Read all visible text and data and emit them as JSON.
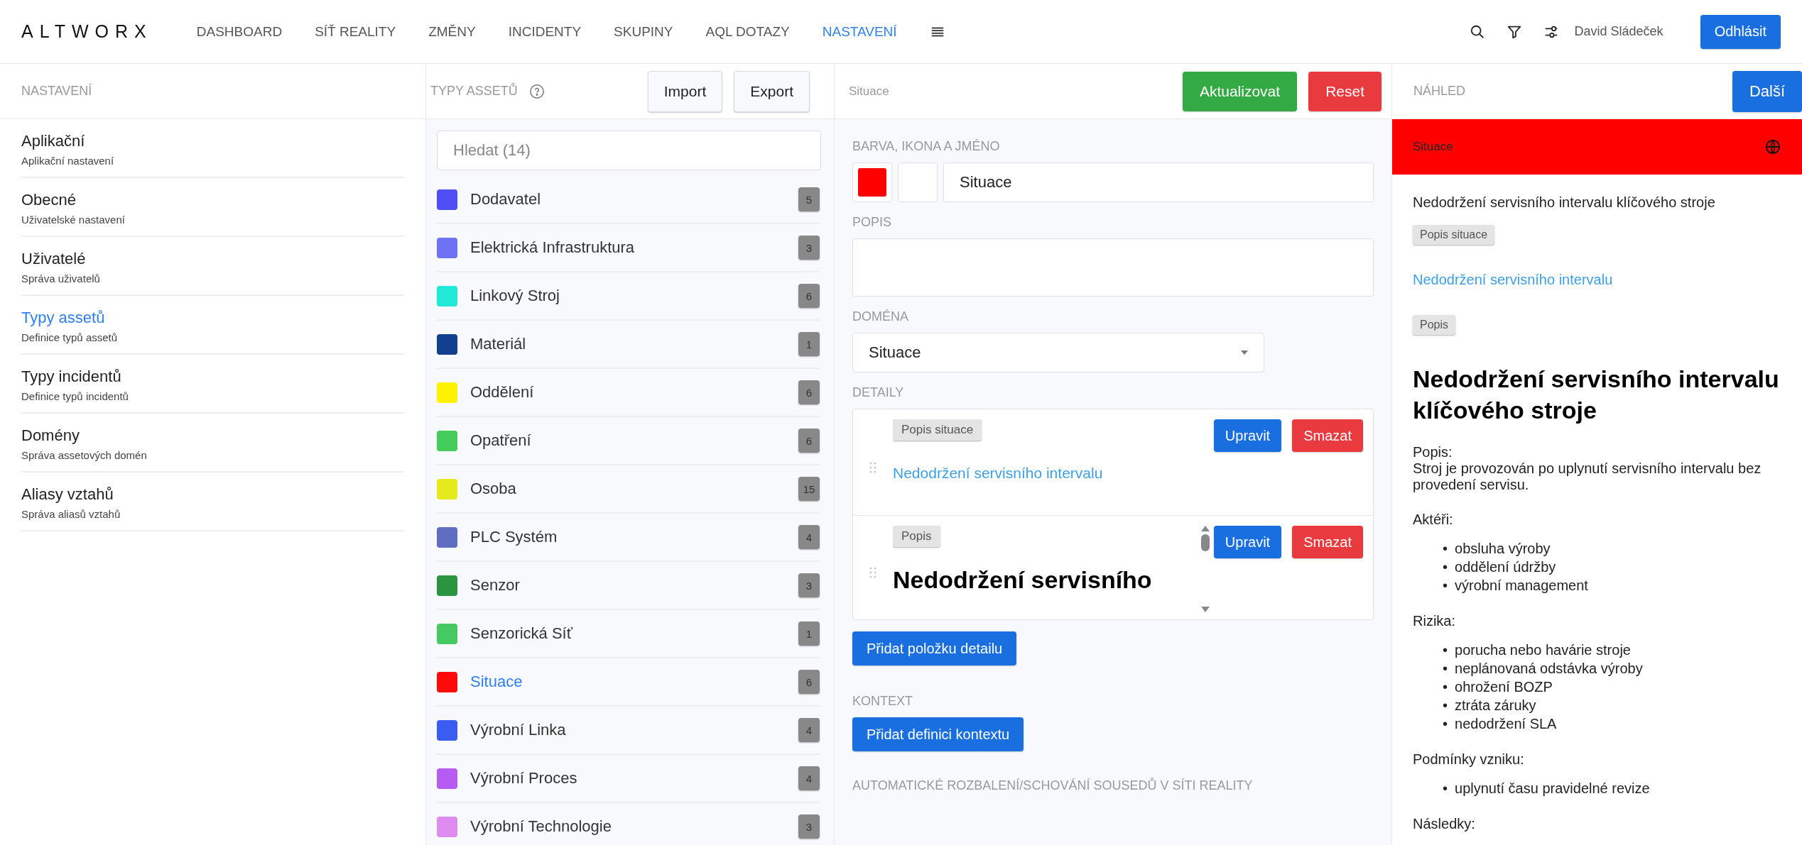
{
  "brand": "ALTWORX",
  "nav": [
    {
      "label": "DASHBOARD",
      "selected": false
    },
    {
      "label": "SÍŤ REALITY",
      "selected": false
    },
    {
      "label": "ZMĚNY",
      "selected": false
    },
    {
      "label": "INCIDENTY",
      "selected": false
    },
    {
      "label": "SKUPINY",
      "selected": false
    },
    {
      "label": "AQL DOTAZY",
      "selected": false
    },
    {
      "label": "NASTAVENÍ",
      "selected": true
    }
  ],
  "user": "David Sládeček",
  "logout": "Odhlásit",
  "settings": {
    "title": "NASTAVENÍ",
    "items": [
      {
        "title": "Aplikační",
        "subtitle": "Aplikační nastavení",
        "selected": false
      },
      {
        "title": "Obecné",
        "subtitle": "Uživatelské nastavení",
        "selected": false
      },
      {
        "title": "Uživatelé",
        "subtitle": "Správa uživatelů",
        "selected": false
      },
      {
        "title": "Typy assetů",
        "subtitle": "Definice typů assetů",
        "selected": true
      },
      {
        "title": "Typy incidentů",
        "subtitle": "Definice typů incidentů",
        "selected": false
      },
      {
        "title": "Domény",
        "subtitle": "Správa assetových domén",
        "selected": false
      },
      {
        "title": "Aliasy vztahů",
        "subtitle": "Správa aliasů vztahů",
        "selected": false
      }
    ]
  },
  "asset_types": {
    "title": "TYPY ASSETŮ",
    "buttons": [
      "Import",
      "Export"
    ],
    "search": {
      "placeholder": "Hledat (14)"
    },
    "items": [
      {
        "name": "Dodavatel",
        "count": "5",
        "color": "#4f4ff5",
        "selected": false
      },
      {
        "name": "Elektrická Infrastruktura",
        "count": "3",
        "color": "#6f72f5",
        "selected": false
      },
      {
        "name": "Linkový Stroj",
        "count": "6",
        "color": "#22e8d8",
        "selected": false
      },
      {
        "name": "Materiál",
        "count": "1",
        "color": "#133f8f",
        "selected": false
      },
      {
        "name": "Oddělení",
        "count": "6",
        "color": "#fff200",
        "selected": false
      },
      {
        "name": "Opatření",
        "count": "6",
        "color": "#44cc5a",
        "selected": false
      },
      {
        "name": "Osoba",
        "count": "15",
        "color": "#e4ea1c",
        "selected": false
      },
      {
        "name": "PLC Systém",
        "count": "4",
        "color": "#5f6ec0",
        "selected": false
      },
      {
        "name": "Senzor",
        "count": "3",
        "color": "#2b9440",
        "selected": false
      },
      {
        "name": "Senzorická Síť",
        "count": "1",
        "color": "#46c862",
        "selected": false
      },
      {
        "name": "Situace",
        "count": "6",
        "color": "#ff0a0a",
        "selected": true
      },
      {
        "name": "Výrobní Linka",
        "count": "4",
        "color": "#3a5cf0",
        "selected": false
      },
      {
        "name": "Výrobní Proces",
        "count": "4",
        "color": "#b65cf2",
        "selected": false
      },
      {
        "name": "Výrobní Technologie",
        "count": "3",
        "color": "#de8cf0",
        "selected": false
      }
    ]
  },
  "editor": {
    "title": "Situace",
    "buttons": [
      {
        "label": "Aktualizovat",
        "kind": "success"
      },
      {
        "label": "Reset",
        "kind": "danger"
      }
    ],
    "name_label": "BARVA, IKONA A JMÉNO",
    "color": "#ff0000",
    "name": "Situace",
    "description_label": "POPIS",
    "domain_label": "DOMÉNA",
    "domain": "Situace",
    "details_label": "DETAILY",
    "details": [
      {
        "tag": "Popis situace",
        "kind": "link",
        "content": "Nedodržení servisního intervalu",
        "edit": "Upravit",
        "delete": "Smazat"
      },
      {
        "tag": "Popis",
        "kind": "heading",
        "content": "Nedodržení servisního",
        "edit": "Upravit",
        "delete": "Smazat"
      }
    ],
    "add_detail": "Přidat položku detailu",
    "context_label": "KONTEXT",
    "add_context": "Přidat definici kontextu",
    "auto_label": "AUTOMATICKÉ ROZBALENÍ/SCHOVÁNÍ SOUSEDŮ V SÍTI REALITY"
  },
  "preview": {
    "title": "NÁHLED",
    "next": "Další",
    "bar_title": "Situace",
    "summary": "Nedodržení servisního intervalu klíčového stroje",
    "tag1": "Popis situace",
    "link": "Nedodržení servisního intervalu",
    "tag2": "Popis",
    "heading": "Nedodržení servisního intervalu klíčového stroje",
    "sections": [
      {
        "title": "Popis:",
        "text": "Stroj je provozován po uplynutí servisního intervalu bez provedení servisu."
      },
      {
        "title": "Aktéři:",
        "items": [
          {
            "bullet": "•",
            "text": "obsluha výroby"
          },
          {
            "bullet": "•",
            "text": "oddělení údržby"
          },
          {
            "bullet": "•",
            "text": "výrobní management"
          }
        ]
      },
      {
        "title": "Rizika:",
        "items": [
          {
            "bullet": "•",
            "text": "porucha nebo havárie stroje"
          },
          {
            "bullet": "•",
            "text": "neplánovaná odstávka výroby"
          },
          {
            "bullet": "•",
            "text": "ohrožení BOZP"
          },
          {
            "bullet": "•",
            "text": "ztráta záruky"
          },
          {
            "bullet": "•",
            "text": "nedodržení SLA"
          }
        ]
      },
      {
        "title": "Podmínky vzniku:",
        "items": [
          {
            "bullet": "•",
            "text": "uplynutí času pravidelné revize"
          }
        ]
      },
      {
        "title": "Následky:"
      }
    ]
  }
}
